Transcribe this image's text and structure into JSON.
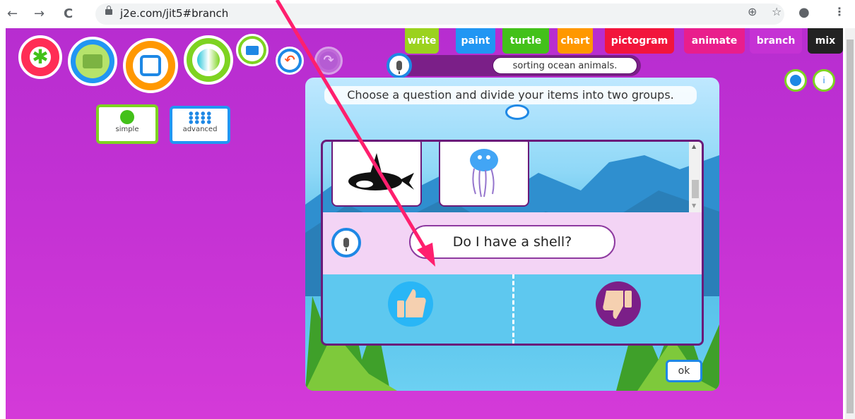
{
  "browser": {
    "url": "j2e.com/jit5#branch",
    "back_icon": "←",
    "forward_icon": "→",
    "reload_icon": "C",
    "zoom_icon": "⊕",
    "star_icon": "☆",
    "account_icon": "●",
    "menu_icon": "⋮"
  },
  "tabs": [
    {
      "label": "write",
      "color": "#9bd21e"
    },
    {
      "label": "paint",
      "color": "#2196f3"
    },
    {
      "label": "turtle",
      "color": "#43c11a"
    },
    {
      "label": "chart",
      "color": "#ff9800"
    },
    {
      "label": "pictogram",
      "color": "#f2153c"
    },
    {
      "label": "animate",
      "color": "#e91e8c"
    },
    {
      "label": "branch",
      "color": "#c532d4"
    },
    {
      "label": "mix",
      "color": "#222222"
    }
  ],
  "modes": {
    "simple": "simple",
    "advanced": "advanced"
  },
  "title_field": "sorting ocean animals.",
  "instruction": "Choose a question and divide your items into two groups.",
  "question": "Do I have a shell?",
  "ok_label": "ok",
  "info_label": "i",
  "colors": {
    "accent": "#c532d4",
    "frame": "#6a1b7a",
    "arrow": "#ff1f6e"
  }
}
